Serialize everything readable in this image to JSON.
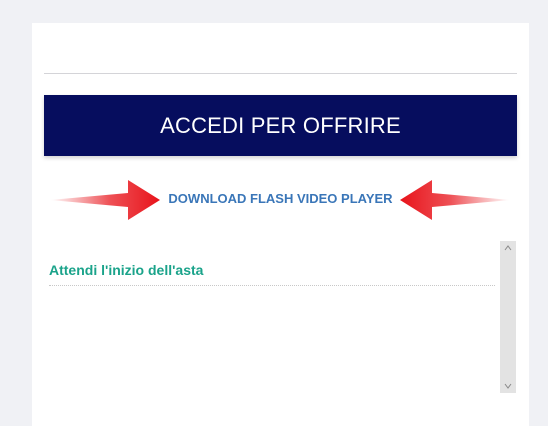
{
  "login": {
    "label": "ACCEDI PER OFFRIRE"
  },
  "flash": {
    "label": "DOWNLOAD FLASH VIDEO PLAYER"
  },
  "auction": {
    "status": "Attendi l'inizio dell'asta"
  },
  "colors": {
    "page_bg": "#f0f1f5",
    "login_bg": "#060d5e",
    "link": "#3a76b8",
    "status_text": "#1aa38a",
    "arrow": "#e8141b"
  },
  "icons": {
    "left_arrow": "arrow-right-icon",
    "right_arrow": "arrow-left-icon",
    "scroll_up": "chevron-up-icon",
    "scroll_down": "chevron-down-icon"
  }
}
